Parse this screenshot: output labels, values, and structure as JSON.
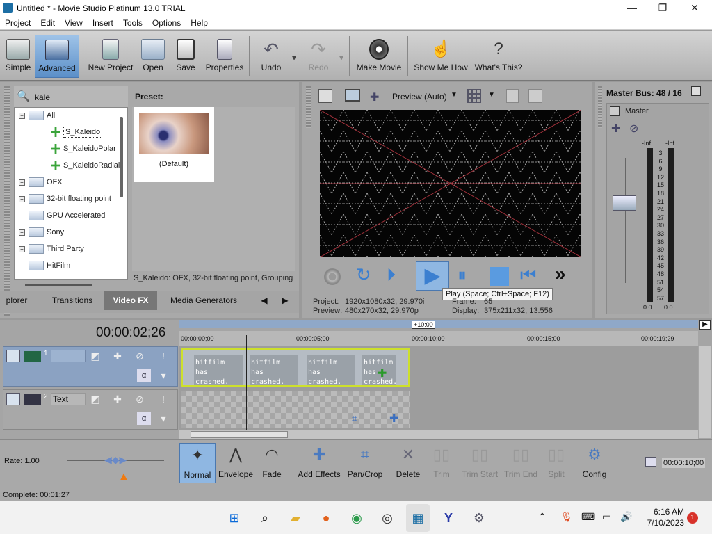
{
  "window": {
    "title": "Untitled * - Movie Studio Platinum 13.0 TRIAL",
    "minimize": "—",
    "maximize": "❐",
    "close": "✕"
  },
  "menu": [
    "Project",
    "Edit",
    "View",
    "Insert",
    "Tools",
    "Options",
    "Help"
  ],
  "toolbar": {
    "simple": "Simple",
    "advanced": "Advanced",
    "new_project": "New Project",
    "open": "Open",
    "save": "Save",
    "properties": "Properties",
    "undo": "Undo",
    "redo": "Redo",
    "make_movie": "Make Movie",
    "show_me_how": "Show Me How",
    "whats_this": "What's This?"
  },
  "fx": {
    "search_value": "kale",
    "preset_label": "Preset:",
    "preset_default": "(Default)",
    "description": "S_Kaleido: OFX, 32-bit floating point, Grouping",
    "tree": [
      {
        "label": "All",
        "level": 0,
        "type": "folder",
        "expand": "−"
      },
      {
        "label": "S_Kaleido",
        "level": 1,
        "type": "fx",
        "selected": true
      },
      {
        "label": "S_KaleidoPolar",
        "level": 1,
        "type": "fx"
      },
      {
        "label": "S_KaleidoRadial",
        "level": 1,
        "type": "fx"
      },
      {
        "label": "OFX",
        "level": 0,
        "type": "folder",
        "expand": "+"
      },
      {
        "label": "32-bit floating point",
        "level": 0,
        "type": "folder",
        "expand": "+"
      },
      {
        "label": "GPU Accelerated",
        "level": 0,
        "type": "folder",
        "expand": ""
      },
      {
        "label": "Sony",
        "level": 0,
        "type": "folder",
        "expand": "+"
      },
      {
        "label": "Third Party",
        "level": 0,
        "type": "folder",
        "expand": "+"
      },
      {
        "label": "HitFilm",
        "level": 0,
        "type": "folder",
        "expand": ""
      }
    ],
    "tabs": [
      "plorer",
      "Transitions",
      "Video FX",
      "Media Generators"
    ]
  },
  "preview": {
    "mode": "Preview (Auto)",
    "tooltip": "Play (Space; Ctrl+Space; F12)",
    "project_label": "Project:",
    "project_value": "1920x1080x32, 29.970i",
    "preview_label": "Preview:",
    "preview_value": "480x270x32, 29.970p",
    "frame_label": "Frame:",
    "frame_value": "65",
    "display_label": "Display:",
    "display_value": "375x211x32, 13.556"
  },
  "master": {
    "title": "Master Bus: 48 / 16",
    "label": "Master",
    "inf_left": "-Inf.",
    "inf_right": "-Inf.",
    "scale": [
      "3",
      "6",
      "9",
      "12",
      "15",
      "18",
      "21",
      "24",
      "27",
      "30",
      "33",
      "36",
      "39",
      "42",
      "45",
      "48",
      "51",
      "54",
      "57"
    ],
    "bottom_left": "0.0",
    "bottom_right": "0.0"
  },
  "timeline": {
    "timecode": "00:00:02;26",
    "marker": "+10:00",
    "ruler": [
      "00:00:00;00",
      "00:00:05;00",
      "00:00:10;00",
      "00:00:15;00",
      "00:00:19;29"
    ],
    "tracks": [
      {
        "num": "1",
        "name": ""
      },
      {
        "num": "2",
        "name": "Text"
      }
    ],
    "clip_text": [
      "hitfilm has crashed.",
      "hitfilm has crashed.",
      "hitfilm has crashed.",
      "hitfilm has crashed."
    ]
  },
  "bottom": {
    "rate": "Rate: 1.00",
    "normal": "Normal",
    "envelope": "Envelope",
    "fade": "Fade",
    "add_effects": "Add Effects",
    "pan_crop": "Pan/Crop",
    "delete": "Delete",
    "trim": "Trim",
    "trim_start": "Trim Start",
    "trim_end": "Trim End",
    "split": "Split",
    "config": "Config",
    "time": "00:00:10;00"
  },
  "status": "Complete: 00:01:27",
  "taskbar": {
    "time": "6:16 AM",
    "date": "7/10/2023",
    "badge": "1"
  }
}
